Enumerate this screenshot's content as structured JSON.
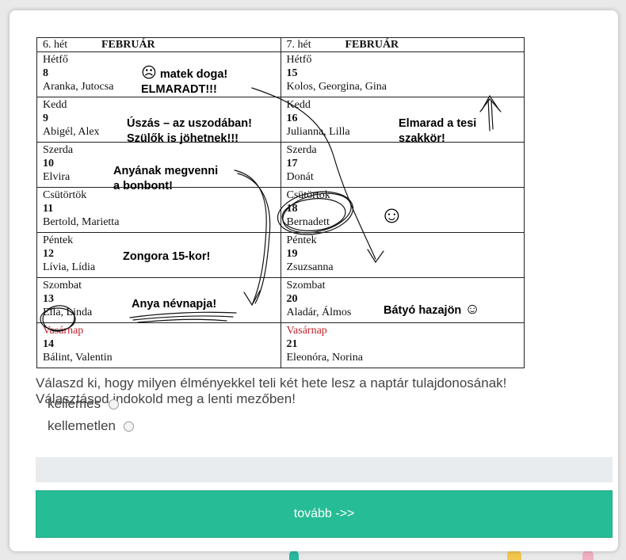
{
  "calendar": {
    "weeks": [
      {
        "week_label": "6. hét",
        "month": "FEBRUÁR",
        "days": [
          {
            "day_name": "Hétfő",
            "date": "8",
            "names": "Aranka, Jutocsa"
          },
          {
            "day_name": "Kedd",
            "date": "9",
            "names": "Abigél, Alex"
          },
          {
            "day_name": "Szerda",
            "date": "10",
            "names": "Elvira"
          },
          {
            "day_name": "Csütörtök",
            "date": "11",
            "names": "Bertold, Marietta"
          },
          {
            "day_name": "Péntek",
            "date": "12",
            "names": "Lívia, Lídia"
          },
          {
            "day_name": "Szombat",
            "date": "13",
            "names": "Ella, Linda"
          },
          {
            "day_name": "Vasárnap",
            "date": "14",
            "names": "Bálint, Valentin"
          }
        ]
      },
      {
        "week_label": "7. hét",
        "month": "FEBRUÁR",
        "days": [
          {
            "day_name": "Hétfő",
            "date": "15",
            "names": "Kolos, Georgina, Gina"
          },
          {
            "day_name": "Kedd",
            "date": "16",
            "names": "Julianna, Lilla"
          },
          {
            "day_name": "Szerda",
            "date": "17",
            "names": "Donát"
          },
          {
            "day_name": "Csütörtök",
            "date": "18",
            "names": "Bernadett"
          },
          {
            "day_name": "Péntek",
            "date": "19",
            "names": "Zsuzsanna"
          },
          {
            "day_name": "Szombat",
            "date": "20",
            "names": "Aladár, Álmos"
          },
          {
            "day_name": "Vasárnap",
            "date": "21",
            "names": "Eleonóra, Norina"
          }
        ]
      }
    ],
    "notes": {
      "matek_line1": "matek doga!",
      "matek_line2": "ELMARADT!!!",
      "uszas_line1": "Úszás – az uszodában!",
      "uszas_line2": "Szülők is jöhetnek!!!",
      "bonbon_line1": "Anyának megvenni",
      "bonbon_line2": "a bonbont!",
      "zongora": "Zongora 15-kor!",
      "nevnap": "Anya névnapja!",
      "tesi_line1": "Elmarad a tesi",
      "tesi_line2": "szakkör!",
      "batyo": "Bátyó hazajön"
    },
    "sunday_color": "#c0242c"
  },
  "question": {
    "line1": "Válaszd ki, hogy milyen élményekkel teli két hete lesz a naptár tulajdonosának!",
    "line2": "Választásod indokold meg a lenti mezőben!"
  },
  "options": [
    {
      "label": "kellemes",
      "selected": false
    },
    {
      "label": "kellemetlen",
      "selected": false
    }
  ],
  "answer_field": {
    "value": "",
    "placeholder": ""
  },
  "next_button": {
    "label": "tovább ->>"
  },
  "colors": {
    "accent": "#26bd96",
    "field_bg": "#e8ecef",
    "text": "#444444"
  }
}
